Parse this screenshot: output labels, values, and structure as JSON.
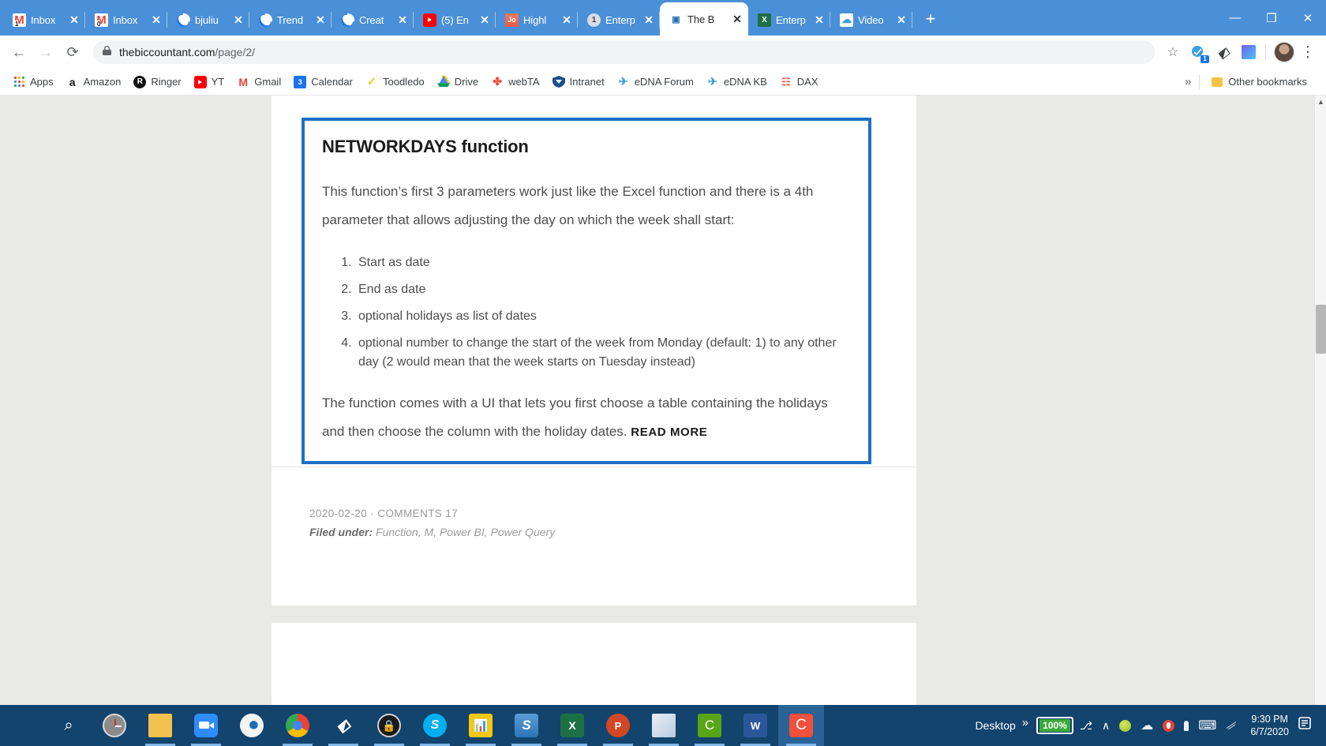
{
  "browser": {
    "tabs": [
      {
        "title": "Inbox",
        "icon": "gmail-icon",
        "badge": "1",
        "active": false
      },
      {
        "title": "Inbox",
        "icon": "gmail-icon",
        "badge": "0",
        "active": false
      },
      {
        "title": "bjuliu",
        "icon": "loading-spinner-icon",
        "active": false
      },
      {
        "title": "Trend",
        "icon": "loading-spinner-icon",
        "active": false
      },
      {
        "title": "Creat",
        "icon": "loading-spinner-icon",
        "active": false
      },
      {
        "title": "(5) En",
        "icon": "youtube-icon",
        "active": false
      },
      {
        "title": "Highl",
        "icon": "highlight-app-icon",
        "active": false
      },
      {
        "title": "Enterp",
        "icon": "circle-one-icon",
        "active": false
      },
      {
        "title": "The B",
        "icon": "powerbi-doc-icon",
        "active": true
      },
      {
        "title": "Enterp",
        "icon": "excel-icon",
        "active": false
      },
      {
        "title": "Video",
        "icon": "cloud-video-icon",
        "active": false
      }
    ],
    "new_tab_label": "+",
    "close_label": "✕",
    "window_controls": {
      "minimize": "—",
      "maximize": "❐",
      "close": "✕"
    },
    "toolbar": {
      "back_label": "←",
      "forward_label": "→",
      "reload_label": "⟳",
      "lock_label": "🔒",
      "url_domain": "thebiccountant.com",
      "url_path": "/page/2/",
      "bookmark_star_label": "☆",
      "extension_badge_count": "1",
      "menu_label": "⋮"
    },
    "bookmarks": [
      {
        "label": "Apps",
        "icon": "apps-grid-icon"
      },
      {
        "label": "Amazon",
        "icon": "amazon-icon",
        "glyph": "a"
      },
      {
        "label": "Ringer",
        "icon": "ringer-icon",
        "glyph": "R"
      },
      {
        "label": "YT",
        "icon": "youtube-icon"
      },
      {
        "label": "Gmail",
        "icon": "gmail-icon",
        "glyph": "M"
      },
      {
        "label": "Calendar",
        "icon": "calendar-icon",
        "glyph": "3"
      },
      {
        "label": "Toodledo",
        "icon": "checkmark-icon",
        "glyph": "✓"
      },
      {
        "label": "Drive",
        "icon": "google-drive-icon"
      },
      {
        "label": "webTA",
        "icon": "webta-icon",
        "glyph": "✤"
      },
      {
        "label": "Intranet",
        "icon": "intranet-shield-icon",
        "glyph": "▼"
      },
      {
        "label": "eDNA Forum",
        "icon": "edna-icon",
        "glyph": "✈"
      },
      {
        "label": "eDNA KB",
        "icon": "edna-icon",
        "glyph": "✈"
      },
      {
        "label": "DAX",
        "icon": "dax-icon",
        "glyph": "☷"
      }
    ],
    "bookmarks_overflow_label": "»",
    "other_bookmarks_label": "Other bookmarks",
    "other_bookmarks_icon": "folder-icon",
    "scrollbar": {
      "up_arrow": "▲"
    }
  },
  "page": {
    "card": {
      "title": "NETWORKDAYS function",
      "paragraph1": "This function’s first 3 parameters work just like the Excel function and there is a 4th parameter that allows adjusting the day on which the week shall start:",
      "list": [
        "Start as date",
        "End as date",
        "optional holidays as list of dates",
        "optional number to change the start of the week from Monday (default: 1) to any other day (2 would mean that the week starts on Tuesday instead)"
      ],
      "paragraph2": "The function comes with a UI that lets you first choose a table containing the holidays and then choose the column with the holiday dates.",
      "read_more_label": "READ MORE",
      "border_color": "#1f6fc4"
    },
    "meta": {
      "date_and_comments": "2020-02-20 · COMMENTS 17",
      "filed_under_label": "Filed under:",
      "filed_under_values": "Function, M, Power BI, Power Query"
    }
  },
  "taskbar": {
    "items": [
      {
        "name": "start-button",
        "icon": "windows-start-icon",
        "open": false
      },
      {
        "name": "search-button",
        "icon": "search-icon",
        "glyph": "⌕",
        "open": false
      },
      {
        "name": "clock-app",
        "icon": "clock-icon",
        "open": false
      },
      {
        "name": "file-explorer",
        "icon": "folder-icon",
        "open": true
      },
      {
        "name": "zoom-app",
        "icon": "zoom-video-icon",
        "open": true
      },
      {
        "name": "eye-app",
        "icon": "eye-icon",
        "open": false
      },
      {
        "name": "chrome-app",
        "icon": "chrome-icon",
        "open": true
      },
      {
        "name": "firefox-app",
        "icon": "firefox-icon",
        "open": true
      },
      {
        "name": "lock-app",
        "icon": "lock-icon",
        "open": true
      },
      {
        "name": "skype-app",
        "icon": "skype-icon",
        "glyph": "S",
        "open": true
      },
      {
        "name": "power-bi-app",
        "icon": "power-bi-icon",
        "open": true
      },
      {
        "name": "snagit-app",
        "icon": "snagit-icon",
        "glyph": "S",
        "open": true
      },
      {
        "name": "excel-app",
        "icon": "excel-icon",
        "glyph": "X",
        "open": true
      },
      {
        "name": "powerpoint-app",
        "icon": "powerpoint-icon",
        "glyph": "P",
        "open": true
      },
      {
        "name": "onenote-app",
        "icon": "onenote-icon",
        "open": true
      },
      {
        "name": "camtasia-app",
        "icon": "camtasia-icon",
        "glyph": "C",
        "open": true
      },
      {
        "name": "word-app",
        "icon": "word-icon",
        "glyph": "W",
        "open": true
      },
      {
        "name": "camtasia-recorder-app",
        "icon": "camtasia-red-icon",
        "glyph": "C",
        "open": true,
        "active": true
      }
    ],
    "desktop_label": "Desktop",
    "tray_overflow_label": "»",
    "battery_percent": "100%",
    "tray_icons": [
      {
        "name": "plug-icon",
        "glyph": "⎇"
      },
      {
        "name": "chevron-up-icon",
        "glyph": "∧"
      },
      {
        "name": "green-status-icon",
        "glyph": ""
      },
      {
        "name": "onedrive-cloud-icon",
        "glyph": "☁"
      },
      {
        "name": "microphone-icon",
        "glyph": "●"
      },
      {
        "name": "usb-device-icon",
        "glyph": "⬇"
      },
      {
        "name": "keyboard-icon",
        "glyph": "⌨"
      },
      {
        "name": "wifi-icon",
        "glyph": "◠"
      }
    ],
    "time": "9:30 PM",
    "date": "6/7/2020",
    "action_center_label": "☷"
  }
}
